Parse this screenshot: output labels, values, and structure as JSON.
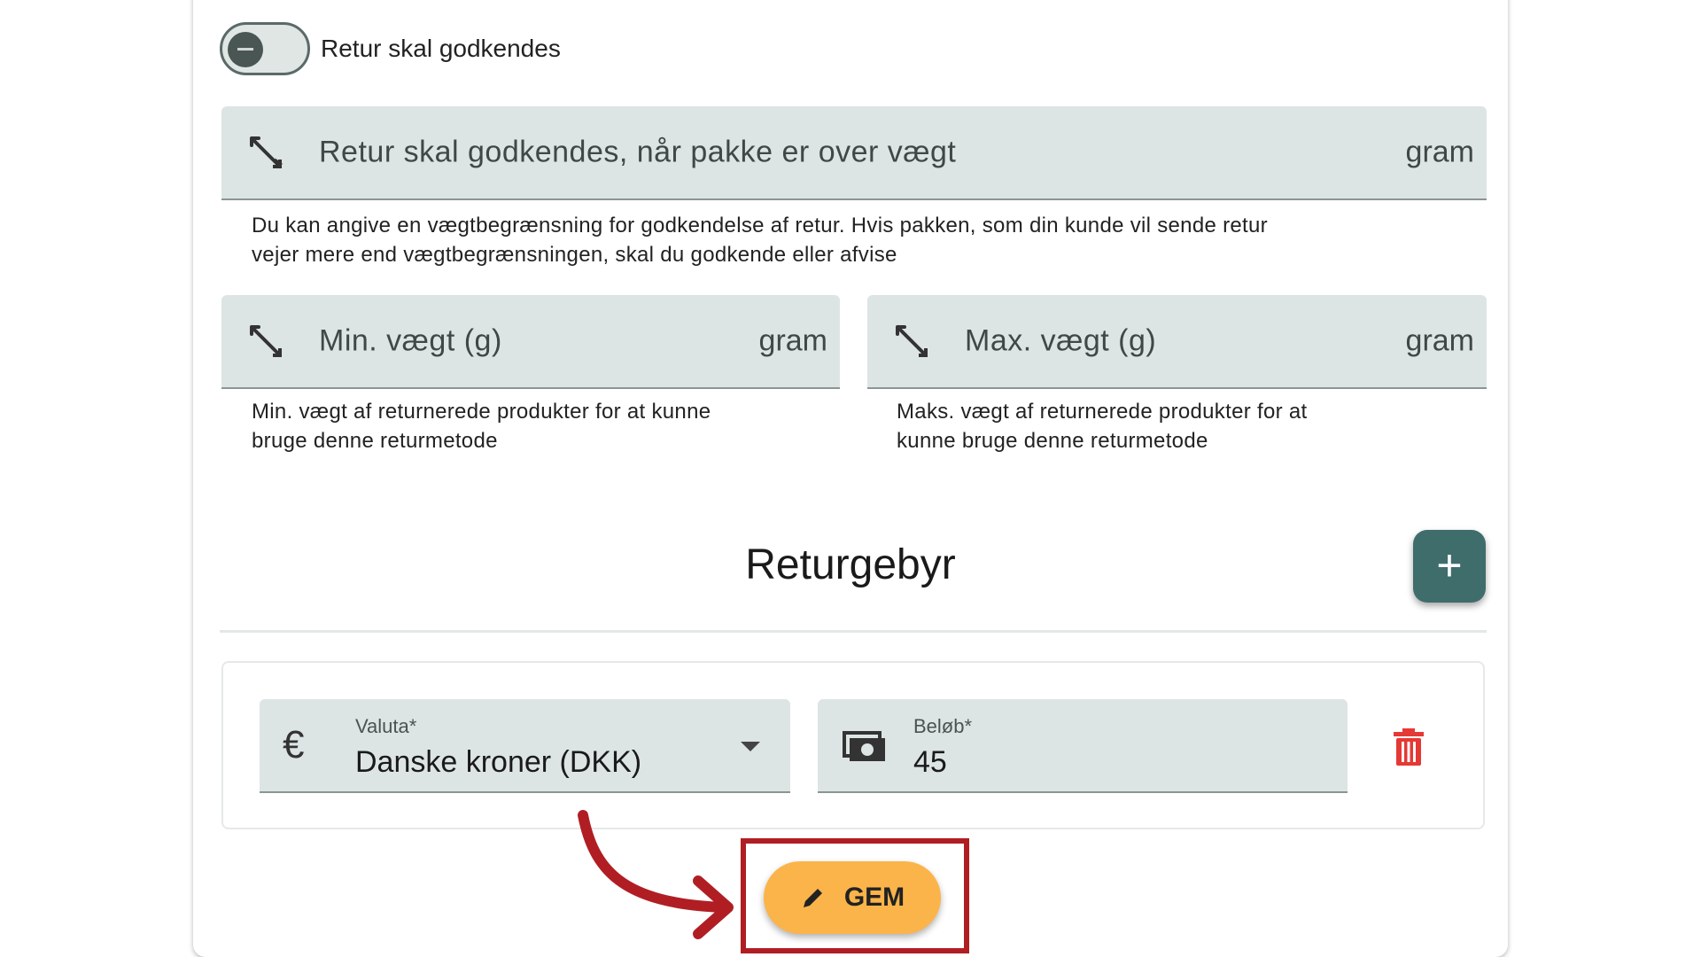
{
  "toggle": {
    "label": "Retur skal godkendes"
  },
  "approval_weight": {
    "label": "Retur skal godkendes, når pakke er over vægt",
    "suffix": "gram",
    "hint_line1": "Du kan angive en vægtbegrænsning for godkendelse af retur. Hvis pakken, som din kunde vil sende retur",
    "hint_line2": "vejer mere end vægtbegrænsningen, skal du godkende eller afvise"
  },
  "min_weight": {
    "label": "Min. vægt (g)",
    "suffix": "gram",
    "hint_line1": "Min. vægt af returnerede produkter for at kunne",
    "hint_line2": "bruge denne returmetode"
  },
  "max_weight": {
    "label": "Max. vægt (g)",
    "suffix": "gram",
    "hint_line1": "Maks. vægt af returnerede produkter for at",
    "hint_line2": "kunne bruge denne returmetode"
  },
  "return_fee": {
    "title": "Returgebyr",
    "add_symbol": "+",
    "currency": {
      "label": "Valuta*",
      "value": "Danske kroner (DKK)",
      "icon_glyph": "€"
    },
    "amount": {
      "label": "Beløb*",
      "value": "45"
    }
  },
  "save_button": {
    "label": "GEM"
  },
  "colors": {
    "accent_teal": "#3f6d6c",
    "field_bg": "#dde5e4",
    "save_orange": "#fbb44a",
    "highlight_red": "#b01e24",
    "delete_red": "#e53935"
  }
}
